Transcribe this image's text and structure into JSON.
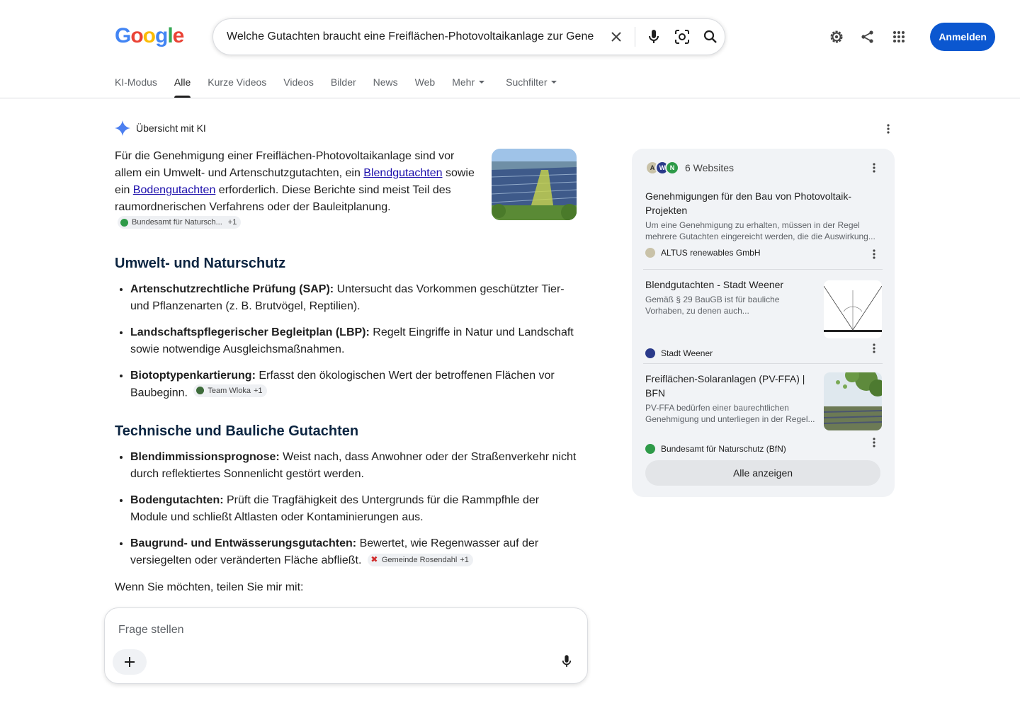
{
  "logo": {
    "letters": [
      "G",
      "o",
      "o",
      "g",
      "l",
      "e"
    ]
  },
  "search": {
    "query": "Welche Gutachten braucht eine Freiflächen-Photovoltaikanlage zur Genehmigung"
  },
  "header": {
    "signin_label": "Anmelden"
  },
  "tabs": [
    {
      "label": "KI-Modus"
    },
    {
      "label": "Alle"
    },
    {
      "label": "Kurze Videos"
    },
    {
      "label": "Videos"
    },
    {
      "label": "Bilder"
    },
    {
      "label": "News"
    },
    {
      "label": "Web"
    },
    {
      "label": "Mehr"
    },
    {
      "label": "Suchfilter"
    }
  ],
  "ai_overview": {
    "title": "Übersicht mit KI",
    "intro": {
      "part1": "Für die Genehmigung einer Freiflächen-Photovoltaikanlage sind vor allem ein Umwelt- und Artenschutzgutachten, ein ",
      "link1": "Blendgutachten",
      "part2": " sowie ein ",
      "link2": "Bodengutachten",
      "part3": " erforderlich. Diese Berichte sind meist Teil des raumordnerischen Verfahrens oder der Bauleitplanung.",
      "chip": {
        "source": "Bundesamt für Natursch...",
        "more": "+1"
      }
    },
    "section1": {
      "heading": "Umwelt- und Naturschutz",
      "items": [
        {
          "bold": "Artenschutzrechtliche Prüfung (SAP):",
          "text": " Untersucht das Vorkommen geschützter Tier- und Pflanzenarten (z. B. Brutvögel, Reptilien)."
        },
        {
          "bold": "Landschaftspflegerischer Begleitplan (LBP):",
          "text": " Regelt Eingriffe in Natur und Landschaft sowie notwendige Ausgleichsmaßnahmen."
        },
        {
          "bold": "Biotoptypenkartierung:",
          "text": " Erfasst den ökologischen Wert der betroffenen Flächen vor Baubeginn."
        }
      ],
      "chip": {
        "source": "Team Wloka",
        "more": "+1"
      }
    },
    "section2": {
      "heading": "Technische und Bauliche Gutachten",
      "items": [
        {
          "bold": "Blendimmissionsprognose:",
          "text": " Weist nach, dass Anwohner oder der Straßenverkehr nicht durch reflektiertes Sonnenlicht gestört werden."
        },
        {
          "bold": "Bodengutachten:",
          "text": " Prüft die Tragfähigkeit des Untergrunds für die Rammpfhle der Module und schließt Altlasten oder Kontaminierungen aus."
        },
        {
          "bold": "Baugrund- und Entwässerungsgutachten:",
          "text": " Bewertet, wie Regenwasser auf der versiegelten oder veränderten Fläche abfließt."
        }
      ],
      "chip": {
        "source": "Gemeinde Rosendahl",
        "more": "+1"
      }
    },
    "after": "Wenn Sie möchten, teilen Sie mir mit:"
  },
  "ask": {
    "placeholder": "Frage stellen"
  },
  "panel": {
    "count_label": "6 Websites",
    "sources": [
      {
        "title": "Genehmigungen für den Bau von Photovoltaik-Projekten",
        "desc": "Um eine Genehmigung zu erhalten, müssen in der Regel mehrere Gutachten eingereicht werden, die die Auswirkung...",
        "site": "ALTUS renewables GmbH"
      },
      {
        "title": "Blendgutachten - Stadt Weener",
        "desc": "Gemäß § 29 BauGB ist für bauliche Vorhaben, zu denen auch...",
        "site": "Stadt Weener"
      },
      {
        "title": "Freiflächen-Solaranlagen (PV-FFA) | BFN",
        "desc": "PV-FFA bedürfen einer baurechtlichen Genehmigung und unterliegen in der Regel...",
        "site": "Bundesamt für Naturschutz (BfN)"
      }
    ],
    "show_all": "Alle anzeigen"
  },
  "colors": {
    "accent": "#0b57d0",
    "link": "#1a0dab",
    "heading": "#0b2440",
    "panel_bg": "#f1f3f6"
  }
}
